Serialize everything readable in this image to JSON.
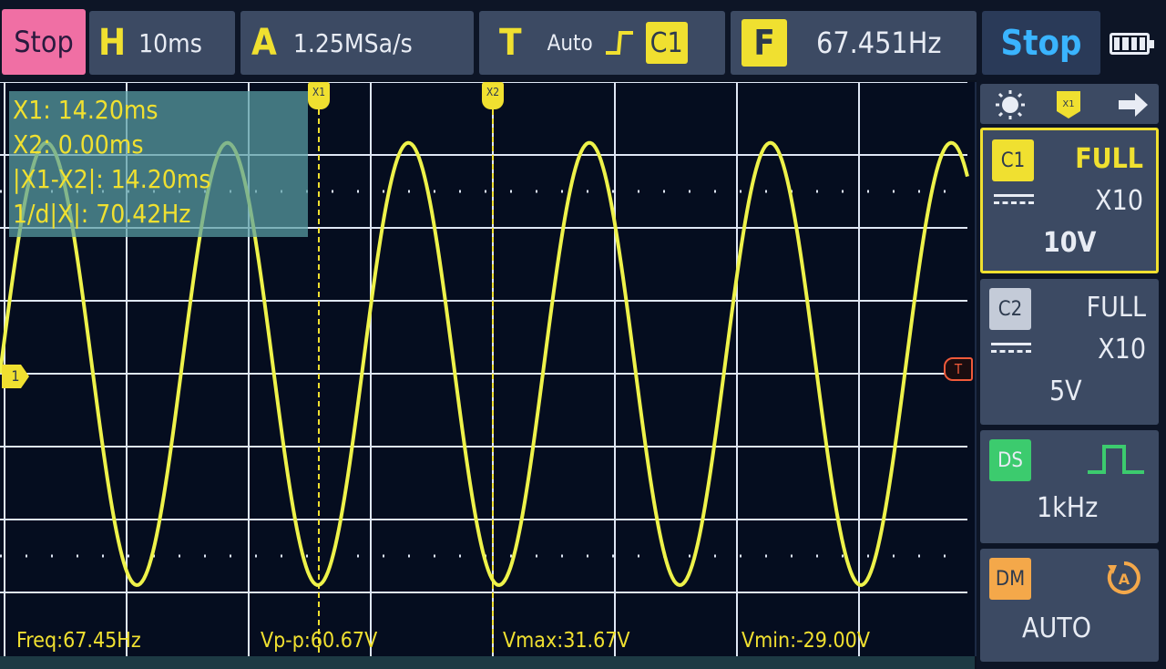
{
  "topbar": {
    "status": "Stop",
    "horizontal": {
      "letter": "H",
      "value": "10ms"
    },
    "acquisition": {
      "letter": "A",
      "value": "1.25MSa/s"
    },
    "trigger": {
      "letter": "T",
      "mode": "Auto",
      "source": "C1"
    },
    "frequency": {
      "letter": "F",
      "value": "67.451Hz"
    },
    "run_button": "Stop"
  },
  "cursors": {
    "x1_marker": "X1",
    "x2_marker": "X2",
    "readout": [
      "X1: 14.20ms",
      "X2: 0.00ms",
      "|X1-X2|: 14.20ms",
      "1/d|X|: 70.42Hz"
    ]
  },
  "plot": {
    "ch1_marker": "1",
    "trigger_marker": "T",
    "trace_color": "#eef24a",
    "grid_color": "#dfe7f5",
    "chart_data": {
      "type": "line",
      "series": [
        {
          "name": "C1",
          "waveform": "sine",
          "frequency_hz": 67.451,
          "vpp_v": 60.67,
          "vmax_v": 31.67,
          "vmin_v": -29.0
        }
      ],
      "x_per_div": "10ms",
      "grid": true
    }
  },
  "measurements": {
    "freq": "Freq:67.45Hz",
    "vpp": "Vp-p:60.67V",
    "vmax": "Vmax:31.67V",
    "vmin": "Vmin:-29.00V"
  },
  "side": {
    "c1": {
      "tag": "C1",
      "coupling": "FULL",
      "probe": "X10",
      "scale": "10V"
    },
    "c2": {
      "tag": "C2",
      "coupling": "FULL",
      "probe": "X10",
      "scale": "5V"
    },
    "ds": {
      "tag": "DS",
      "freq": "1kHz"
    },
    "dm": {
      "tag": "DM",
      "mode": "AUTO"
    }
  },
  "colors": {
    "accent_yellow": "#f0e030",
    "stop_pink": "#f06fa4",
    "run_blue": "#3ab4ff",
    "ds_green": "#3ccb6e",
    "dm_orange": "#f4a84a"
  }
}
